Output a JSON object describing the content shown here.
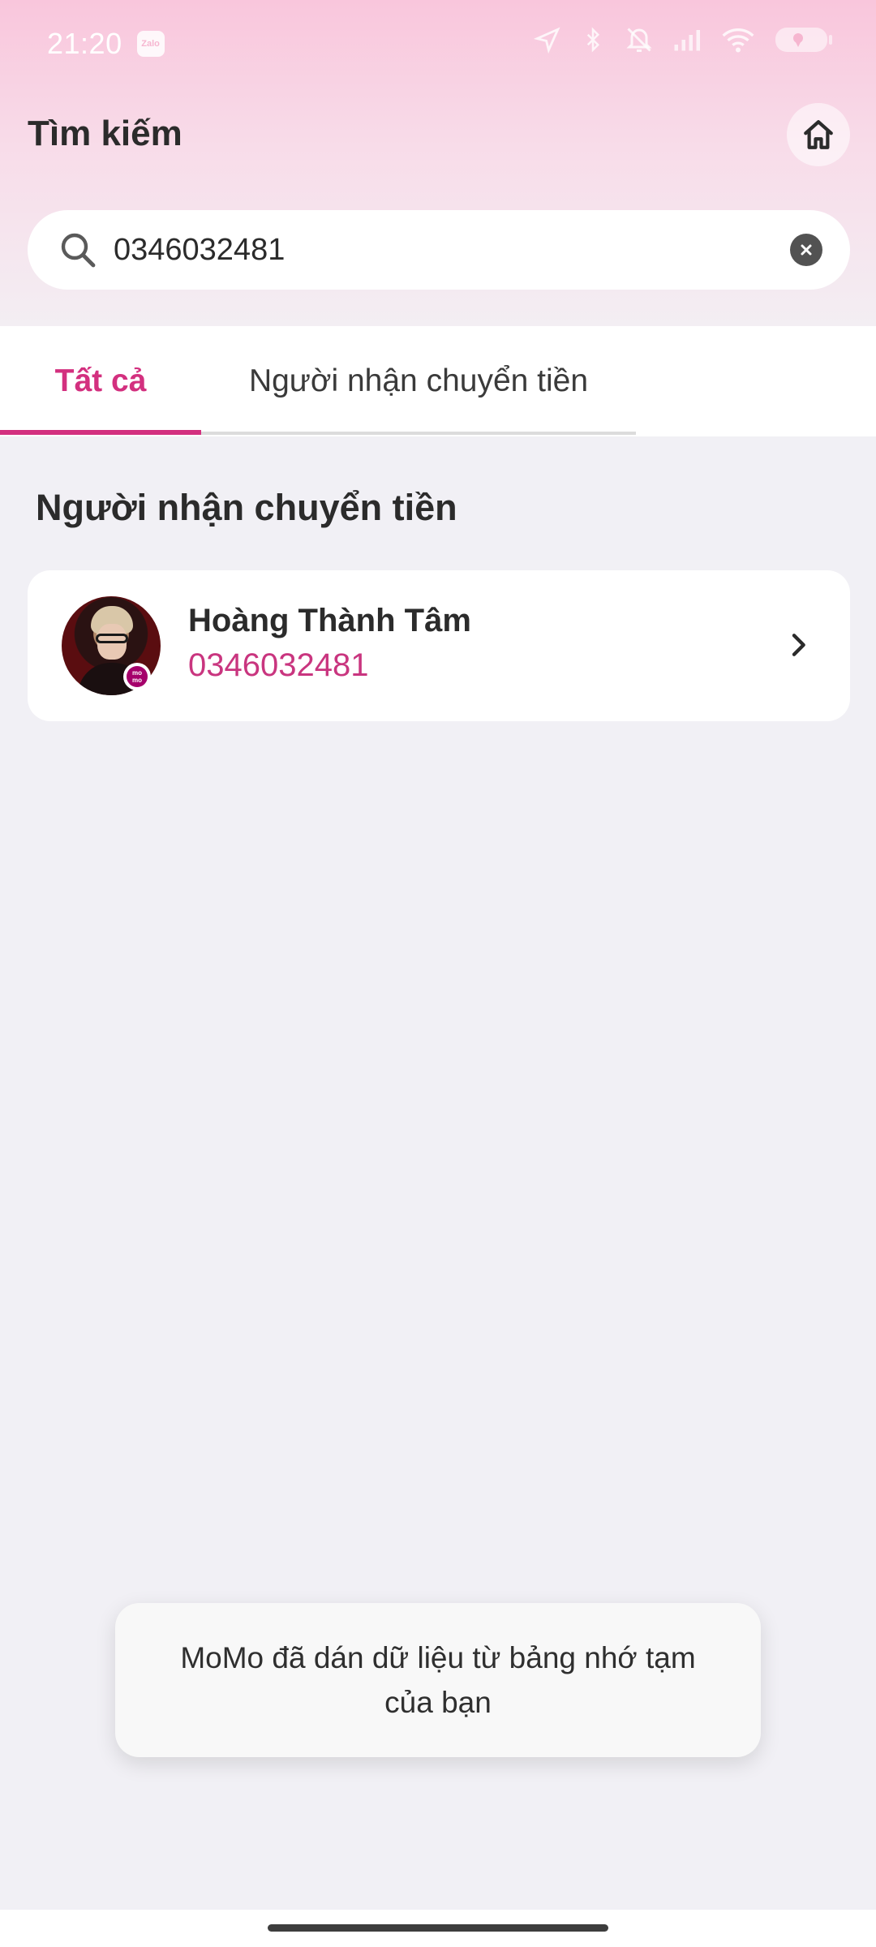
{
  "status_bar": {
    "time": "21:20",
    "notification_app": "Zalo",
    "icons": [
      "location-icon",
      "bluetooth-icon",
      "mute-icon",
      "signal-icon",
      "wifi-icon",
      "battery-icon"
    ]
  },
  "header": {
    "title": "Tìm kiếm",
    "home_icon": "home-icon"
  },
  "search": {
    "value": "0346032481",
    "placeholder": ""
  },
  "tabs": [
    {
      "label": "Tất cả",
      "active": true
    },
    {
      "label": "Người nhận chuyển tiền",
      "active": false
    }
  ],
  "results": {
    "section_title": "Người nhận chuyển tiền",
    "items": [
      {
        "name": "Hoàng Thành Tâm",
        "phone": "0346032481",
        "badge": "momo"
      }
    ]
  },
  "toast": {
    "message": "MoMo đã dán dữ liệu từ bảng nhớ tạm của bạn"
  },
  "colors": {
    "accent": "#d3307f",
    "phone_text": "#c9357f",
    "header_gradient_top": "#f9c6dc",
    "background": "#f1f0f5"
  }
}
